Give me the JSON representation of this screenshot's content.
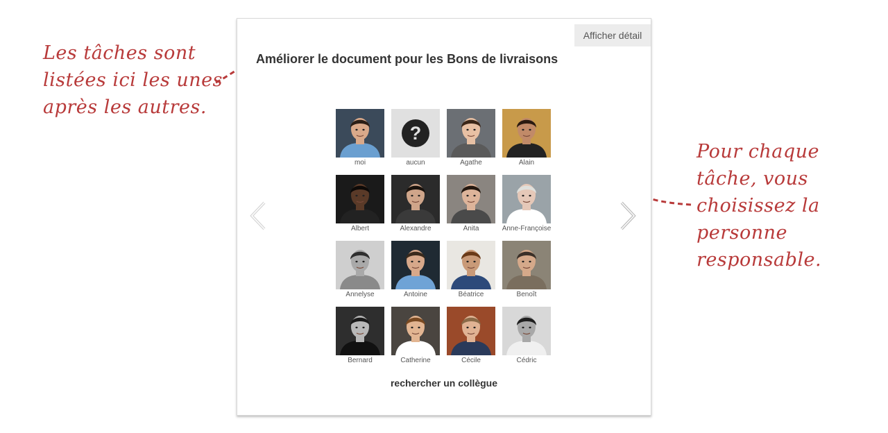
{
  "annotations": {
    "left": [
      "Les tâches sont",
      "listées ici les unes",
      "après les autres."
    ],
    "right": [
      "Pour chaque",
      "tâche, vous",
      "choisissez la",
      "personne",
      "responsable."
    ],
    "color": "#b83a3a"
  },
  "card": {
    "detail_button": "Afficher détail",
    "task_title": "Améliorer le document pour les Bons de livraisons",
    "prev_icon": "chevron-left-icon",
    "next_icon": "chevron-right-icon",
    "search_link": "rechercher un collègue"
  },
  "people": [
    {
      "name": "moi",
      "bg": "#3b4a5a",
      "skin": "#d9a98a",
      "hair": "#2a1e16",
      "cloth": "#6a9fd0",
      "bw": false
    },
    {
      "name": "aucun",
      "placeholder": true
    },
    {
      "name": "Agathe",
      "bg": "#6b6f74",
      "skin": "#e7c0a4",
      "hair": "#3a2618",
      "cloth": "#5a5a5a",
      "bw": false
    },
    {
      "name": "Alain",
      "bg": "#c89a4a",
      "skin": "#c18a68",
      "hair": "#2a1a10",
      "cloth": "#222222",
      "bw": false
    },
    {
      "name": "Albert",
      "bg": "#1a1a1a",
      "skin": "#5a3a28",
      "hair": "#0e0a08",
      "cloth": "#222222",
      "bw": false
    },
    {
      "name": "Alexandre",
      "bg": "#2b2b2b",
      "skin": "#cfa58a",
      "hair": "#1a120c",
      "cloth": "#3a3a3a",
      "bw": false
    },
    {
      "name": "Anita",
      "bg": "#8a8580",
      "skin": "#ddb49a",
      "hair": "#241810",
      "cloth": "#4a4a4a",
      "bw": false
    },
    {
      "name": "Anne-Françoise",
      "bg": "#9aa3a8",
      "skin": "#e5c8b8",
      "hair": "#dfe0dc",
      "cloth": "#ffffff",
      "bw": false
    },
    {
      "name": "Annelyse",
      "bg": "#cfcfcf",
      "skin": "#a9a9a9",
      "hair": "#2e2e2e",
      "cloth": "#8a8a8a",
      "bw": true
    },
    {
      "name": "Antoine",
      "bg": "#1f2a33",
      "skin": "#d7a88a",
      "hair": "#3a2a1c",
      "cloth": "#6fa3d6",
      "bw": false
    },
    {
      "name": "Béatrice",
      "bg": "#e9e7e2",
      "skin": "#c99a78",
      "hair": "#6a3a18",
      "cloth": "#2d4a7a",
      "bw": false
    },
    {
      "name": "Benoît",
      "bg": "#8b8476",
      "skin": "#d5a98a",
      "hair": "#3a3028",
      "cloth": "#7a6e5e",
      "bw": false
    },
    {
      "name": "Bernard",
      "bg": "#2e2e2e",
      "skin": "#b8b8b8",
      "hair": "#1a1a1a",
      "cloth": "#111111",
      "bw": true
    },
    {
      "name": "Catherine",
      "bg": "#4a4540",
      "skin": "#e2b592",
      "hair": "#7a4a22",
      "cloth": "#ffffff",
      "bw": false
    },
    {
      "name": "Cécile",
      "bg": "#9a4a2a",
      "skin": "#e0b394",
      "hair": "#8a6a48",
      "cloth": "#2a3a5a",
      "bw": false
    },
    {
      "name": "Cédric",
      "bg": "#d8d8d8",
      "skin": "#a8a8a8",
      "hair": "#1e1e1e",
      "cloth": "#f0f0f0",
      "bw": true
    }
  ]
}
